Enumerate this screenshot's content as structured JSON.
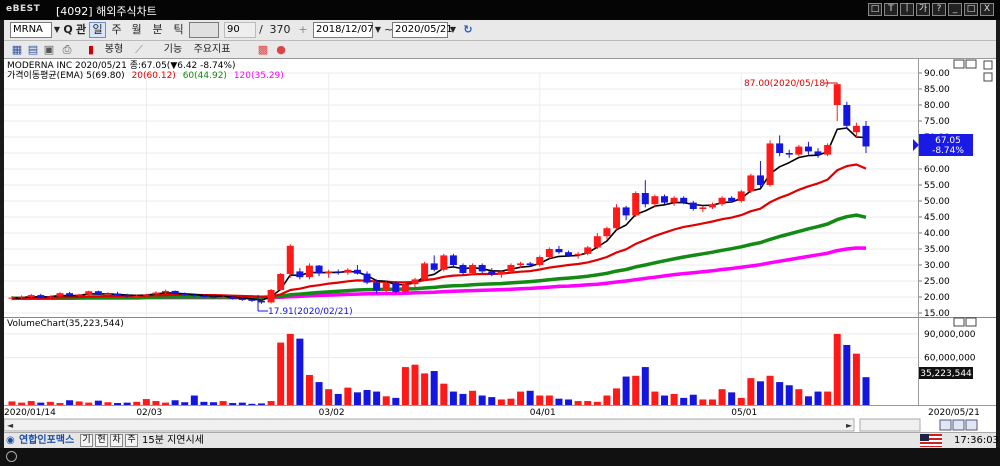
{
  "window": {
    "brand": "eBEST",
    "title": "[4092] 해외주식차트",
    "buttons": [
      "□",
      "T",
      "ㅣ",
      "가",
      "?",
      "_",
      "□",
      "X"
    ]
  },
  "toolbar": {
    "symbol": "MRNA",
    "search_label": "Q",
    "kwan_label": "관",
    "periods": [
      "일",
      "주",
      "월",
      "분",
      "틱"
    ],
    "selected_period": "일",
    "count": "90",
    "slash": "/",
    "total": "370",
    "plus": "+",
    "start_date": "2018/12/07",
    "range_sep": "~",
    "end_date": "2020/05/21"
  },
  "toolbar2": {
    "chart_type": "봉형",
    "func_label": "기능",
    "indicator_label": "주요지표"
  },
  "price_panel": {
    "legend_line1": "MODERNA INC  2020/05/21 종:67.05(▼6.42  -8.74%)",
    "legend_line2_prefix": "가격이동평균(EMA) 5(69.80)",
    "ema20_label": "20(60.12)",
    "ema60_label": "60(44.92)",
    "ema120_label": "120(35.29)",
    "high_annotation": "87.00(2020/05/18)",
    "low_annotation": "17.91(2020/02/21)",
    "current_price": "67.05",
    "current_change": "-8.74%",
    "y_ticks": [
      "90.00",
      "85.00",
      "80.00",
      "75.00",
      "70.00",
      "65.00",
      "60.00",
      "55.00",
      "50.00",
      "45.00",
      "40.00",
      "35.00",
      "30.00",
      "25.00",
      "20.00",
      "15.00"
    ]
  },
  "volume_panel": {
    "legend": "VolumeChart(35,223,544)",
    "current_volume": "35,223,544",
    "y_ticks": [
      "90,000,000",
      "60,000,000"
    ]
  },
  "x_axis": {
    "labels": [
      "2020/01/14",
      "02/03",
      "03/02",
      "04/01",
      "05/01",
      "2020/05/21"
    ]
  },
  "bottombar": {
    "brand": "연합인포맥스",
    "chips": [
      "기",
      "현",
      "차",
      "주"
    ],
    "delay_text": "15분 지연시세"
  },
  "statusbar": {
    "time": "17:36:03"
  },
  "colors": {
    "up": "#ff1a1a",
    "down": "#1515e0",
    "ema5": "#000000",
    "ema20": "#e00000",
    "ema60": "#138a13",
    "ema120": "#ff00ff"
  },
  "chart_data": {
    "type": "candlestick",
    "x_start": "2020/01/14",
    "x_end": "2020/05/21",
    "ylim": [
      15,
      90
    ],
    "candles": [
      {
        "o": 19.5,
        "h": 20.3,
        "l": 19.0,
        "c": 19.8
      },
      {
        "o": 19.8,
        "h": 20.5,
        "l": 19.3,
        "c": 20.1
      },
      {
        "o": 20.0,
        "h": 21.0,
        "l": 19.6,
        "c": 20.6
      },
      {
        "o": 20.6,
        "h": 21.0,
        "l": 19.5,
        "c": 19.8
      },
      {
        "o": 19.9,
        "h": 20.5,
        "l": 19.2,
        "c": 20.2
      },
      {
        "o": 20.2,
        "h": 21.5,
        "l": 20.0,
        "c": 21.2
      },
      {
        "o": 21.2,
        "h": 21.6,
        "l": 20.2,
        "c": 20.4
      },
      {
        "o": 20.4,
        "h": 21.0,
        "l": 20.0,
        "c": 20.8
      },
      {
        "o": 20.8,
        "h": 22.0,
        "l": 20.5,
        "c": 21.8
      },
      {
        "o": 21.8,
        "h": 22.0,
        "l": 20.6,
        "c": 20.9
      },
      {
        "o": 20.9,
        "h": 21.5,
        "l": 20.3,
        "c": 21.1
      },
      {
        "o": 21.1,
        "h": 21.6,
        "l": 20.4,
        "c": 20.6
      },
      {
        "o": 20.6,
        "h": 21.0,
        "l": 19.8,
        "c": 20.2
      },
      {
        "o": 20.2,
        "h": 20.8,
        "l": 19.6,
        "c": 20.4
      },
      {
        "o": 20.4,
        "h": 21.0,
        "l": 20.0,
        "c": 20.8
      },
      {
        "o": 20.8,
        "h": 21.8,
        "l": 20.5,
        "c": 21.4
      },
      {
        "o": 21.4,
        "h": 22.3,
        "l": 21.0,
        "c": 21.9
      },
      {
        "o": 21.9,
        "h": 22.0,
        "l": 20.8,
        "c": 21.0
      },
      {
        "o": 21.0,
        "h": 21.4,
        "l": 20.4,
        "c": 20.7
      },
      {
        "o": 20.7,
        "h": 21.1,
        "l": 20.1,
        "c": 20.3
      },
      {
        "o": 20.3,
        "h": 20.8,
        "l": 19.8,
        "c": 20.1
      },
      {
        "o": 20.1,
        "h": 20.6,
        "l": 19.6,
        "c": 19.9
      },
      {
        "o": 19.9,
        "h": 20.4,
        "l": 19.5,
        "c": 20.0
      },
      {
        "o": 20.0,
        "h": 20.3,
        "l": 19.2,
        "c": 19.4
      },
      {
        "o": 19.4,
        "h": 20.0,
        "l": 18.8,
        "c": 19.2
      },
      {
        "o": 19.2,
        "h": 19.6,
        "l": 18.5,
        "c": 18.8
      },
      {
        "o": 18.8,
        "h": 19.3,
        "l": 17.91,
        "c": 18.3
      },
      {
        "o": 18.3,
        "h": 22.5,
        "l": 18.0,
        "c": 22.2
      },
      {
        "o": 22.2,
        "h": 27.5,
        "l": 22.0,
        "c": 27.2
      },
      {
        "o": 27.2,
        "h": 36.5,
        "l": 26.0,
        "c": 36.0
      },
      {
        "o": 28.0,
        "h": 29.0,
        "l": 25.5,
        "c": 26.2
      },
      {
        "o": 26.2,
        "h": 30.5,
        "l": 25.5,
        "c": 29.8
      },
      {
        "o": 29.8,
        "h": 30.0,
        "l": 26.5,
        "c": 27.5
      },
      {
        "o": 27.5,
        "h": 28.5,
        "l": 26.0,
        "c": 28.0
      },
      {
        "o": 28.0,
        "h": 28.6,
        "l": 27.0,
        "c": 27.6
      },
      {
        "o": 27.6,
        "h": 29.0,
        "l": 27.0,
        "c": 28.5
      },
      {
        "o": 28.5,
        "h": 30.0,
        "l": 27.0,
        "c": 27.3
      },
      {
        "o": 27.3,
        "h": 28.0,
        "l": 24.0,
        "c": 24.5
      },
      {
        "o": 24.5,
        "h": 25.5,
        "l": 21.0,
        "c": 22.0
      },
      {
        "o": 22.0,
        "h": 25.0,
        "l": 21.5,
        "c": 24.5
      },
      {
        "o": 24.5,
        "h": 25.0,
        "l": 21.0,
        "c": 21.6
      },
      {
        "o": 21.6,
        "h": 24.5,
        "l": 21.0,
        "c": 24.0
      },
      {
        "o": 24.0,
        "h": 26.0,
        "l": 23.0,
        "c": 25.5
      },
      {
        "o": 25.5,
        "h": 31.0,
        "l": 25.0,
        "c": 30.5
      },
      {
        "o": 30.5,
        "h": 33.0,
        "l": 28.0,
        "c": 28.5
      },
      {
        "o": 28.5,
        "h": 33.5,
        "l": 28.0,
        "c": 33.0
      },
      {
        "o": 33.0,
        "h": 33.5,
        "l": 29.5,
        "c": 30.0
      },
      {
        "o": 30.0,
        "h": 30.5,
        "l": 27.0,
        "c": 27.5
      },
      {
        "o": 27.5,
        "h": 30.5,
        "l": 27.0,
        "c": 30.0
      },
      {
        "o": 30.0,
        "h": 30.5,
        "l": 27.5,
        "c": 28.0
      },
      {
        "o": 28.0,
        "h": 29.0,
        "l": 26.5,
        "c": 27.0
      },
      {
        "o": 27.0,
        "h": 28.5,
        "l": 26.0,
        "c": 28.0
      },
      {
        "o": 28.0,
        "h": 30.5,
        "l": 27.5,
        "c": 30.0
      },
      {
        "o": 30.0,
        "h": 31.0,
        "l": 29.0,
        "c": 30.5
      },
      {
        "o": 30.5,
        "h": 31.0,
        "l": 29.5,
        "c": 30.0
      },
      {
        "o": 30.0,
        "h": 33.0,
        "l": 29.5,
        "c": 32.5
      },
      {
        "o": 32.5,
        "h": 35.5,
        "l": 32.0,
        "c": 35.0
      },
      {
        "o": 35.0,
        "h": 36.0,
        "l": 33.5,
        "c": 34.0
      },
      {
        "o": 34.0,
        "h": 34.5,
        "l": 32.5,
        "c": 33.0
      },
      {
        "o": 33.0,
        "h": 34.0,
        "l": 32.0,
        "c": 33.5
      },
      {
        "o": 33.5,
        "h": 36.0,
        "l": 33.0,
        "c": 35.5
      },
      {
        "o": 35.5,
        "h": 40.0,
        "l": 35.0,
        "c": 39.0
      },
      {
        "o": 39.0,
        "h": 42.0,
        "l": 38.0,
        "c": 41.5
      },
      {
        "o": 41.5,
        "h": 49.0,
        "l": 41.0,
        "c": 48.0
      },
      {
        "o": 48.0,
        "h": 48.5,
        "l": 44.0,
        "c": 45.5
      },
      {
        "o": 45.5,
        "h": 53.0,
        "l": 45.0,
        "c": 52.5
      },
      {
        "o": 52.5,
        "h": 56.5,
        "l": 48.0,
        "c": 49.0
      },
      {
        "o": 49.0,
        "h": 52.0,
        "l": 48.0,
        "c": 51.5
      },
      {
        "o": 51.5,
        "h": 52.0,
        "l": 49.0,
        "c": 49.5
      },
      {
        "o": 49.5,
        "h": 51.5,
        "l": 48.5,
        "c": 51.0
      },
      {
        "o": 51.0,
        "h": 51.5,
        "l": 49.0,
        "c": 49.5
      },
      {
        "o": 49.5,
        "h": 50.0,
        "l": 47.0,
        "c": 47.5
      },
      {
        "o": 47.5,
        "h": 48.5,
        "l": 46.5,
        "c": 48.0
      },
      {
        "o": 48.0,
        "h": 49.5,
        "l": 47.5,
        "c": 49.0
      },
      {
        "o": 49.0,
        "h": 51.5,
        "l": 48.5,
        "c": 51.0
      },
      {
        "o": 51.0,
        "h": 51.5,
        "l": 49.5,
        "c": 50.0
      },
      {
        "o": 50.0,
        "h": 53.5,
        "l": 49.5,
        "c": 53.0
      },
      {
        "o": 53.0,
        "h": 58.5,
        "l": 52.5,
        "c": 58.0
      },
      {
        "o": 58.0,
        "h": 62.5,
        "l": 54.0,
        "c": 55.0
      },
      {
        "o": 55.0,
        "h": 69.0,
        "l": 54.5,
        "c": 68.0
      },
      {
        "o": 68.0,
        "h": 70.5,
        "l": 64.0,
        "c": 65.0
      },
      {
        "o": 65.0,
        "h": 66.0,
        "l": 63.5,
        "c": 64.5
      },
      {
        "o": 64.5,
        "h": 67.5,
        "l": 64.0,
        "c": 67.0
      },
      {
        "o": 67.0,
        "h": 68.5,
        "l": 64.5,
        "c": 65.5
      },
      {
        "o": 65.5,
        "h": 66.5,
        "l": 63.5,
        "c": 64.5
      },
      {
        "o": 64.5,
        "h": 68.0,
        "l": 64.0,
        "c": 67.5
      },
      {
        "o": 80.0,
        "h": 87.0,
        "l": 75.0,
        "c": 86.5
      },
      {
        "o": 80.0,
        "h": 81.0,
        "l": 72.5,
        "c": 73.5
      },
      {
        "o": 71.5,
        "h": 74.5,
        "l": 70.0,
        "c": 73.47
      },
      {
        "o": 73.47,
        "h": 75.0,
        "l": 65.0,
        "c": 67.05
      }
    ],
    "volumes": [
      4.5,
      3.0,
      5.0,
      3.0,
      4.0,
      2.5,
      6.0,
      4.5,
      3.0,
      5.5,
      3.5,
      2.5,
      3.0,
      4.0,
      7.5,
      5.0,
      3.0,
      6.0,
      3.5,
      12.0,
      4.0,
      3.5,
      5.0,
      2.5,
      3.0,
      1.5,
      2.0,
      5.0,
      79.0,
      90.0,
      84.0,
      38.0,
      29.0,
      20.0,
      14.0,
      22.0,
      16.0,
      19.0,
      17.0,
      11.0,
      9.0,
      48.0,
      51.0,
      40.0,
      43.0,
      27.0,
      17.0,
      14.0,
      18.0,
      12.0,
      10.0,
      7.0,
      8.0,
      17.0,
      18.0,
      12.0,
      12.0,
      8.0,
      7.0,
      5.0,
      5.0,
      4.0,
      12.0,
      21.0,
      36.0,
      37.0,
      48.0,
      17.0,
      12.0,
      14.0,
      9.0,
      13.0,
      7.0,
      7.0,
      20.0,
      16.0,
      9.0,
      34.0,
      30.0,
      37.0,
      29.0,
      25.0,
      20.0,
      11.0,
      17.0,
      17.0,
      90.0,
      76.0,
      65.0,
      35.223544
    ],
    "vol_ylim": [
      0,
      100
    ],
    "ema5": [
      19.6,
      19.8,
      20.1,
      20.0,
      20.1,
      20.5,
      20.4,
      20.5,
      21.0,
      20.9,
      21.0,
      20.8,
      20.6,
      20.5,
      20.6,
      20.9,
      21.3,
      21.2,
      21.0,
      20.8,
      20.5,
      20.3,
      20.2,
      19.9,
      19.7,
      19.4,
      19.0,
      20.1,
      22.4,
      26.9,
      26.7,
      27.7,
      27.6,
      27.7,
      27.7,
      28.0,
      27.8,
      26.7,
      25.1,
      24.9,
      23.8,
      23.9,
      24.4,
      26.4,
      27.1,
      29.1,
      29.4,
      28.8,
      29.2,
      28.8,
      28.2,
      28.1,
      28.7,
      29.3,
      29.6,
      30.5,
      32.0,
      32.7,
      32.8,
      33.0,
      33.8,
      35.6,
      37.5,
      41.0,
      42.5,
      45.8,
      46.9,
      48.4,
      48.8,
      49.5,
      49.5,
      48.9,
      48.6,
      48.7,
      49.5,
      49.7,
      50.8,
      53.2,
      53.8,
      58.5,
      60.7,
      62.0,
      63.6,
      64.2,
      64.3,
      65.4,
      72.4,
      72.8,
      70.0,
      69.8
    ],
    "ema20": [
      19.6,
      19.6,
      19.7,
      19.7,
      19.7,
      19.9,
      19.9,
      20.0,
      20.2,
      20.2,
      20.3,
      20.3,
      20.3,
      20.3,
      20.4,
      20.5,
      20.6,
      20.7,
      20.7,
      20.7,
      20.6,
      20.6,
      20.5,
      20.4,
      20.3,
      20.2,
      20.1,
      20.2,
      20.8,
      22.2,
      22.6,
      23.3,
      23.7,
      24.2,
      24.5,
      24.9,
      25.2,
      25.1,
      24.8,
      24.8,
      24.6,
      24.6,
      24.7,
      25.3,
      25.6,
      26.3,
      26.7,
      26.8,
      27.1,
      27.2,
      27.2,
      27.3,
      27.6,
      27.9,
      28.1,
      28.6,
      29.2,
      29.6,
      30.0,
      30.3,
      30.8,
      31.6,
      32.5,
      33.9,
      34.9,
      36.6,
      37.8,
      39.1,
      40.1,
      41.1,
      41.9,
      42.4,
      43.0,
      43.6,
      44.3,
      44.8,
      45.6,
      46.8,
      47.6,
      49.6,
      51.0,
      52.1,
      53.5,
      54.6,
      55.5,
      56.7,
      59.6,
      60.9,
      61.4,
      60.12
    ],
    "ema60": [
      19.6,
      19.6,
      19.6,
      19.6,
      19.6,
      19.7,
      19.7,
      19.7,
      19.8,
      19.8,
      19.8,
      19.8,
      19.9,
      19.9,
      19.9,
      19.9,
      20.0,
      20.0,
      20.0,
      20.0,
      20.0,
      20.0,
      20.0,
      20.0,
      20.0,
      20.0,
      19.9,
      20.0,
      20.2,
      20.7,
      20.9,
      21.2,
      21.4,
      21.6,
      21.8,
      22.0,
      22.2,
      22.3,
      22.3,
      22.4,
      22.4,
      22.5,
      22.6,
      22.8,
      23.0,
      23.3,
      23.5,
      23.6,
      23.8,
      24.0,
      24.1,
      24.2,
      24.4,
      24.6,
      24.8,
      25.1,
      25.4,
      25.7,
      25.9,
      26.2,
      26.5,
      26.9,
      27.4,
      28.1,
      28.6,
      29.4,
      30.0,
      30.7,
      31.3,
      31.9,
      32.5,
      33.0,
      33.5,
      34.0,
      34.6,
      35.1,
      35.7,
      36.4,
      37.0,
      38.0,
      38.9,
      39.7,
      40.5,
      41.3,
      42.0,
      42.8,
      44.2,
      45.1,
      45.6,
      44.92
    ],
    "ema120": [
      19.6,
      19.6,
      19.6,
      19.6,
      19.6,
      19.6,
      19.6,
      19.7,
      19.7,
      19.7,
      19.7,
      19.7,
      19.7,
      19.7,
      19.8,
      19.8,
      19.8,
      19.8,
      19.8,
      19.8,
      19.8,
      19.8,
      19.8,
      19.8,
      19.8,
      19.8,
      19.8,
      19.8,
      19.9,
      20.1,
      20.2,
      20.4,
      20.5,
      20.6,
      20.7,
      20.8,
      20.9,
      21.0,
      21.0,
      21.1,
      21.1,
      21.2,
      21.3,
      21.4,
      21.5,
      21.7,
      21.8,
      21.9,
      22.0,
      22.1,
      22.2,
      22.3,
      22.4,
      22.6,
      22.7,
      22.9,
      23.1,
      23.3,
      23.4,
      23.6,
      23.8,
      24.0,
      24.3,
      24.7,
      25.0,
      25.4,
      25.8,
      26.2,
      26.6,
      27.0,
      27.3,
      27.6,
      27.9,
      28.2,
      28.6,
      28.9,
      29.3,
      29.7,
      30.1,
      30.7,
      31.2,
      31.7,
      32.2,
      32.7,
      33.2,
      33.7,
      34.5,
      35.0,
      35.3,
      35.29
    ]
  }
}
